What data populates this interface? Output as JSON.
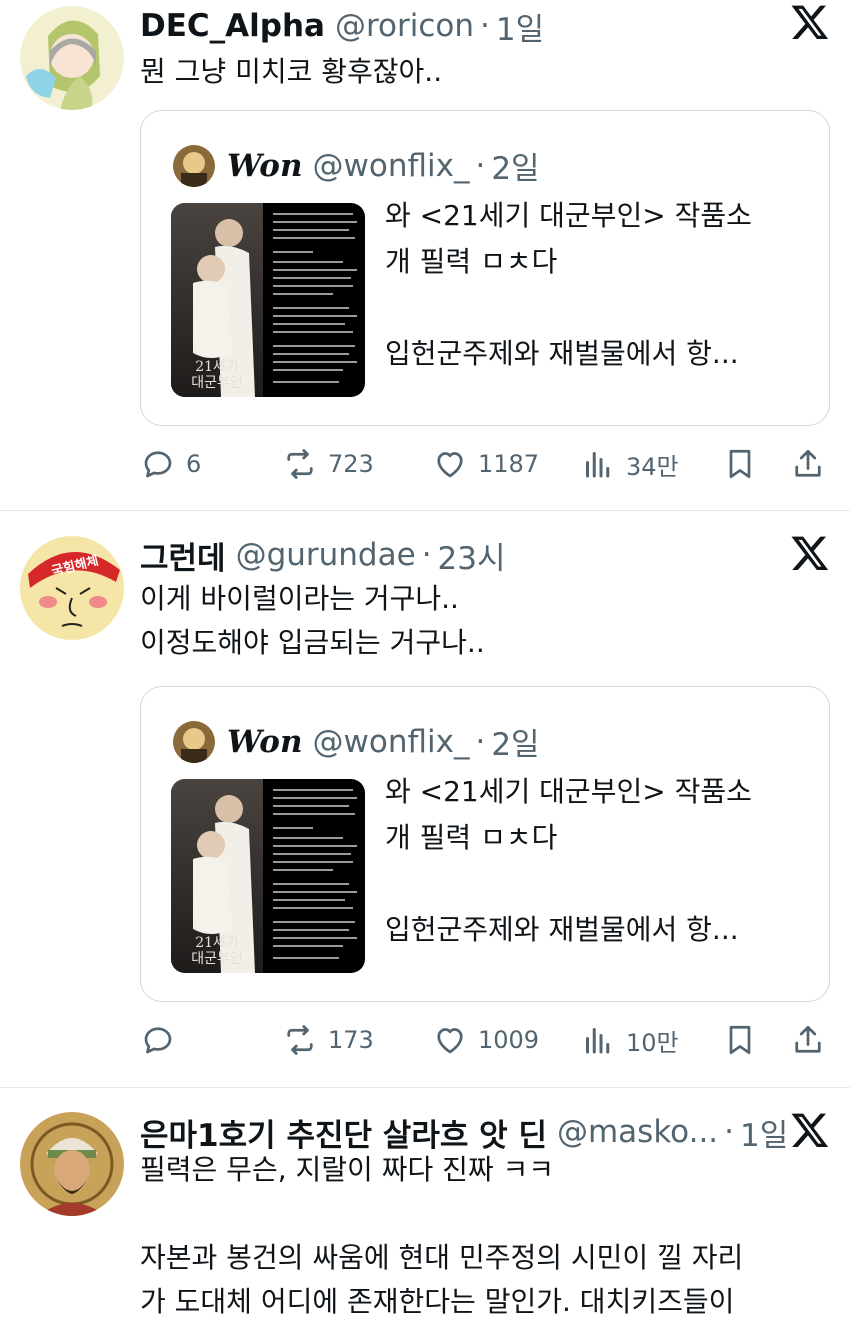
{
  "tweets": [
    {
      "author_name": "DEC_Alpha",
      "handle": "@roricon",
      "dot": "·",
      "time": "1일",
      "text": "뭔 그냥 미치코 황후잖아..",
      "quote": {
        "author_name": "Won",
        "handle": "@wonflix_",
        "dot": "·",
        "time": "2일",
        "text": "와 <21세기 대군부인> 작품소\n개 필력 ㅁㅊ다\n\n입헌군주제와 재벌물에서 항...",
        "thumb_title": "21세기\n대군부인"
      },
      "stats": {
        "replies": "6",
        "retweets": "723",
        "likes": "1187",
        "views": "34만"
      }
    },
    {
      "author_name": "그런데",
      "handle": "@gurundae",
      "dot": "·",
      "time": "23시",
      "avatar_label": "국힘해체",
      "text": "이게 바이럴이라는 거구나..\n이정도해야 입금되는 거구나..",
      "quote": {
        "author_name": "Won",
        "handle": "@wonflix_",
        "dot": "·",
        "time": "2일",
        "text": "와 <21세기 대군부인> 작품소\n개 필력 ㅁㅊ다\n\n입헌군주제와 재벌물에서 항...",
        "thumb_title": "21세기\n대군부인"
      },
      "stats": {
        "replies": "",
        "retweets": "173",
        "likes": "1009",
        "views": "10만"
      }
    },
    {
      "author_name": "은마1호기 추진단 살라흐 앗 딘",
      "handle": "@masko...",
      "dot": "·",
      "time": "1일",
      "text": "필력은 무슨, 지랄이 짜다 진짜 ㅋㅋ\n\n자본과 봉건의 싸움에 현대 민주정의 시민이 낄 자리\n가 도대체 어디에 존재한다는 말인가. 대치키즈들이"
    }
  ],
  "icons": {
    "reply": "reply-icon",
    "retweet": "retweet-icon",
    "like": "heart-icon",
    "views": "views-icon",
    "bookmark": "bookmark-icon",
    "share": "share-icon",
    "platform": "x-logo-icon"
  },
  "colors": {
    "text": "#0f1419",
    "secondary": "#536471",
    "border": "#cfd9de"
  }
}
